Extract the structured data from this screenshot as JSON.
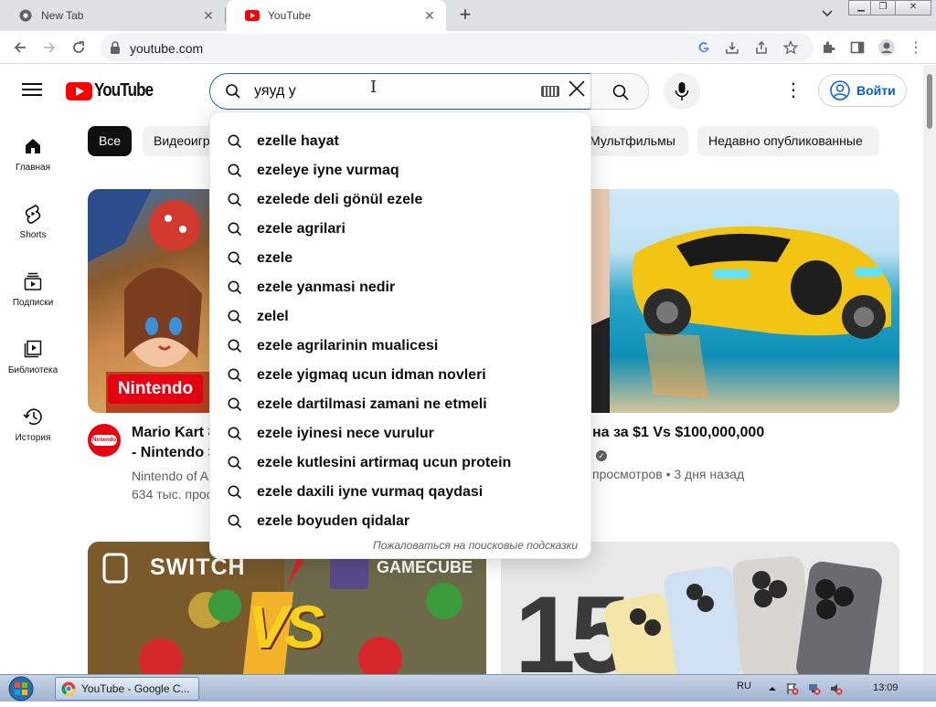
{
  "browser": {
    "tabs": [
      {
        "label": "New Tab",
        "favicon": "chrome-icon"
      },
      {
        "label": "YouTube",
        "favicon": "youtube-icon",
        "active": true
      }
    ],
    "url": "youtube.com",
    "window_controls": [
      "minimize",
      "restore",
      "close"
    ]
  },
  "masthead": {
    "logo_text": "YouTube",
    "search_value": "уяуд у",
    "signin_label": "Войти"
  },
  "sidebar": {
    "items": [
      {
        "label": "Главная",
        "icon": "home-icon"
      },
      {
        "label": "Shorts",
        "icon": "shorts-icon"
      },
      {
        "label": "Подписки",
        "icon": "subscriptions-icon"
      },
      {
        "label": "Библиотека",
        "icon": "library-icon"
      },
      {
        "label": "История",
        "icon": "history-icon"
      }
    ]
  },
  "chips": [
    "Все",
    "Видеоигр",
    "Мультфильмы",
    "Недавно опубликованные"
  ],
  "suggestions": {
    "items": [
      "ezelle hayat",
      "ezeleye iyne vurmaq",
      "ezelede deli gönül ezele",
      "ezele agrilari",
      "ezele",
      "ezele yanmasi nedir",
      "zelel",
      "ezele agrilarinin mualicesi",
      "ezele yigmaq ucun idman novleri",
      "ezele dartilmasi zamani ne etmeli",
      "ezele iyinesi nece vurulur",
      "ezele kutlesini artirmaq ucun protein",
      "ezele daxili iyne vurmaq qaydasi",
      "ezele boyuden qidalar"
    ],
    "report_label": "Пожаловаться на поисковые подсказки"
  },
  "videos": [
    {
      "title_lines": [
        "Mario Kart 8",
        "- Nintendo S"
      ],
      "channel": "Nintendo of A",
      "views": "634 тыс. прос",
      "thumb_badge": "Nintendo",
      "avatar_text": "Nintendo"
    },
    {
      "title": "на за $1 Vs $100,000,000",
      "meta": "просмотров • 3 дня назад"
    },
    {
      "thumb_texts": [
        "SWITCH",
        "GAMECUBE",
        "VS"
      ]
    },
    {
      "thumb_text": "15"
    }
  ],
  "taskbar": {
    "item_label": "YouTube - Google C...",
    "lang": "RU",
    "clock": "13:09"
  },
  "colors": {
    "youtube_red": "#ff0000",
    "link_blue": "#065fd4",
    "search_border": "#1c62b9",
    "chip_active": "#0f0f0f"
  }
}
